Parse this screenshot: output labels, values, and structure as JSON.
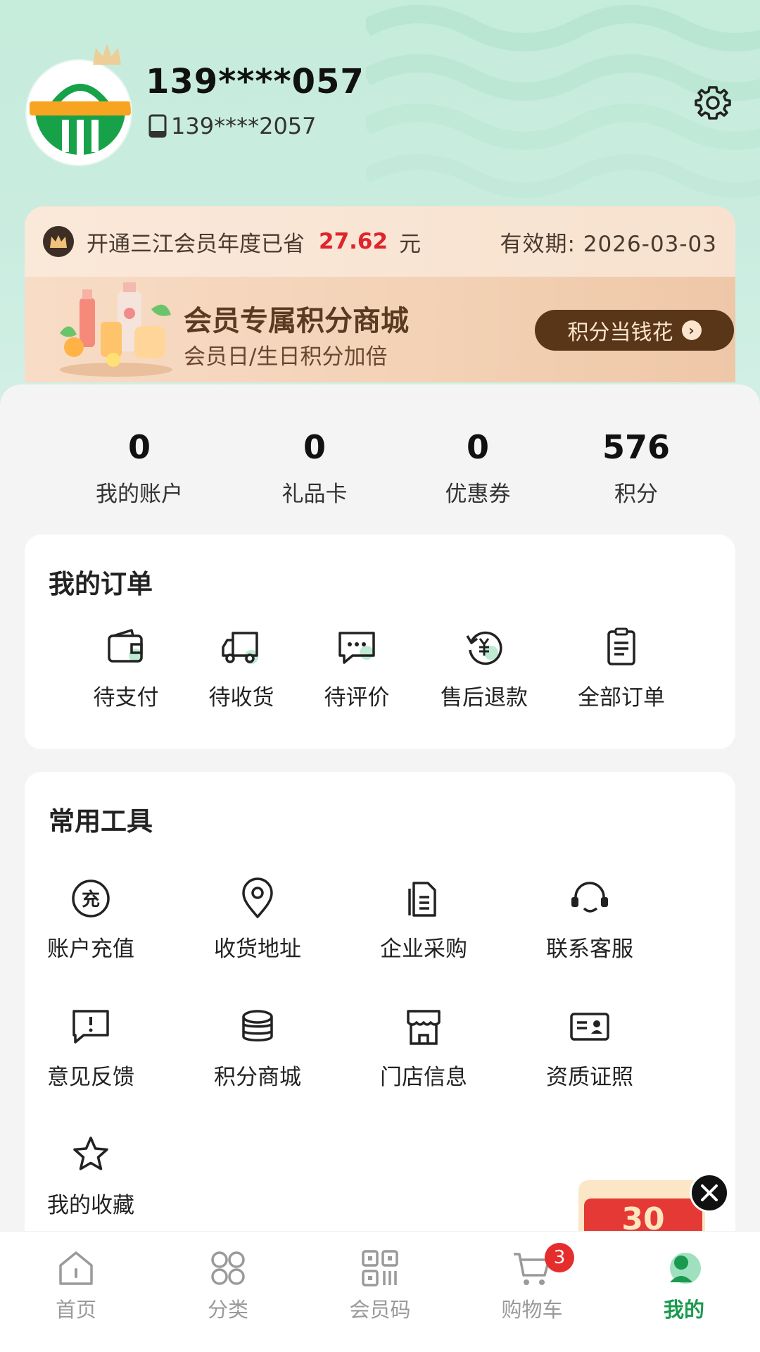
{
  "header": {
    "username": "139****057",
    "phone": "139****2057"
  },
  "member_card": {
    "saved_prefix": "开通三江会员年度已省",
    "saved_amount": "27.62",
    "saved_unit": "元",
    "valid_until": "有效期: 2026-03-03",
    "promo_title": "会员专属积分商城",
    "promo_subtitle": "会员日/生日积分加倍",
    "promo_button": "积分当钱花"
  },
  "stats": [
    {
      "value": "0",
      "label": "我的账户"
    },
    {
      "value": "0",
      "label": "礼品卡"
    },
    {
      "value": "0",
      "label": "优惠券"
    },
    {
      "value": "576",
      "label": "积分"
    }
  ],
  "orders": {
    "title": "我的订单",
    "items": [
      {
        "label": "待支付",
        "icon": "wallet-icon"
      },
      {
        "label": "待收货",
        "icon": "truck-icon"
      },
      {
        "label": "待评价",
        "icon": "comment-icon"
      },
      {
        "label": "售后退款",
        "icon": "refund-icon"
      },
      {
        "label": "全部订单",
        "icon": "clipboard-icon"
      }
    ]
  },
  "tools": {
    "title": "常用工具",
    "items": [
      {
        "label": "账户充值",
        "icon": "recharge-icon"
      },
      {
        "label": "收货地址",
        "icon": "location-icon"
      },
      {
        "label": "企业采购",
        "icon": "documents-icon"
      },
      {
        "label": "联系客服",
        "icon": "headset-icon"
      },
      {
        "label": "意见反馈",
        "icon": "feedback-icon"
      },
      {
        "label": "积分商城",
        "icon": "coins-icon"
      },
      {
        "label": "门店信息",
        "icon": "store-icon"
      },
      {
        "label": "资质证照",
        "icon": "id-card-icon"
      },
      {
        "label": "我的收藏",
        "icon": "star-icon"
      }
    ]
  },
  "recharge_glyph": "充",
  "floating_banner_text": "30",
  "bottom_nav": {
    "items": [
      {
        "label": "首页",
        "icon": "home-icon"
      },
      {
        "label": "分类",
        "icon": "category-icon"
      },
      {
        "label": "会员码",
        "icon": "qr-code-icon"
      },
      {
        "label": "购物车",
        "icon": "cart-icon",
        "badge": "3"
      },
      {
        "label": "我的",
        "icon": "profile-icon",
        "active": true
      }
    ]
  },
  "colors": {
    "brand_green": "#1a9a4e",
    "price_red": "#e0242c",
    "header_bg": "#c6ecdc",
    "promo_button_bg": "#5a3618"
  }
}
